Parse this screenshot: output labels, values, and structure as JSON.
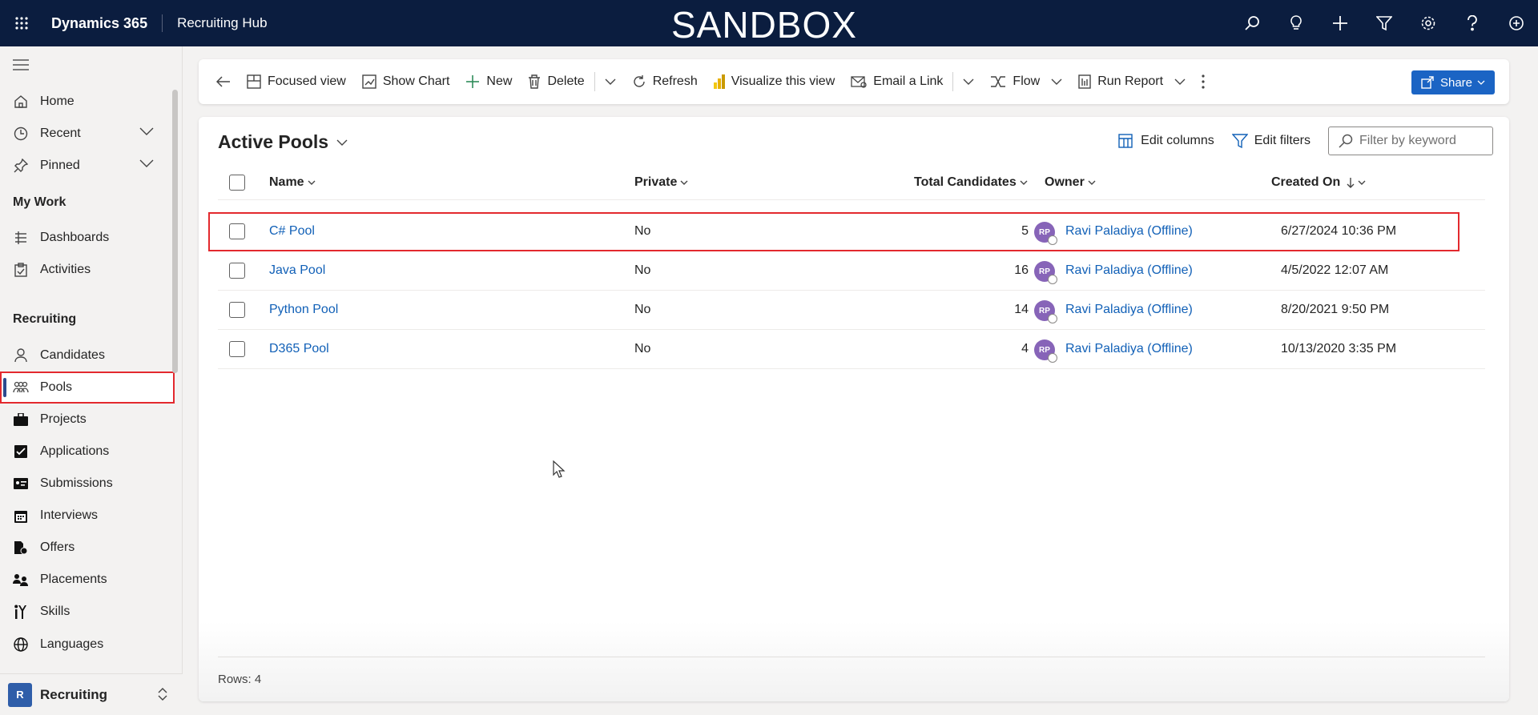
{
  "topbar": {
    "brand": "Dynamics 365",
    "app_name": "Recruiting Hub",
    "environment": "SANDBOX",
    "icons": [
      "search-icon",
      "lightbulb-icon",
      "plus-icon",
      "filter-icon",
      "gear-icon",
      "help-icon",
      "copilot-icon"
    ]
  },
  "sidebar": {
    "home": "Home",
    "recent": "Recent",
    "pinned": "Pinned",
    "my_work_title": "My Work",
    "dashboards": "Dashboards",
    "activities": "Activities",
    "recruiting_title": "Recruiting",
    "candidates": "Candidates",
    "pools": "Pools",
    "projects": "Projects",
    "applications": "Applications",
    "submissions": "Submissions",
    "interviews": "Interviews",
    "offers": "Offers",
    "placements": "Placements",
    "skills": "Skills",
    "languages": "Languages",
    "area_badge": "R",
    "area_label": "Recruiting"
  },
  "commandbar": {
    "focused_view": "Focused view",
    "show_chart": "Show Chart",
    "new": "New",
    "delete": "Delete",
    "refresh": "Refresh",
    "visualize": "Visualize this view",
    "email_link": "Email a Link",
    "flow": "Flow",
    "run_report": "Run Report",
    "share": "Share"
  },
  "view": {
    "title": "Active Pools",
    "edit_columns": "Edit columns",
    "edit_filters": "Edit filters",
    "filter_placeholder": "Filter by keyword",
    "columns": {
      "name": "Name",
      "private": "Private",
      "total": "Total Candidates",
      "owner": "Owner",
      "created": "Created On"
    },
    "rows": [
      {
        "name": "C# Pool",
        "private": "No",
        "total": "5",
        "owner_initials": "RP",
        "owner": "Ravi Paladiya (Offline)",
        "created": "6/27/2024 10:36 PM"
      },
      {
        "name": "Java Pool",
        "private": "No",
        "total": "16",
        "owner_initials": "RP",
        "owner": "Ravi Paladiya (Offline)",
        "created": "4/5/2022 12:07 AM"
      },
      {
        "name": "Python Pool",
        "private": "No",
        "total": "14",
        "owner_initials": "RP",
        "owner": "Ravi Paladiya (Offline)",
        "created": "8/20/2021 9:50 PM"
      },
      {
        "name": "D365 Pool",
        "private": "No",
        "total": "4",
        "owner_initials": "RP",
        "owner": "Ravi Paladiya (Offline)",
        "created": "10/13/2020 3:35 PM"
      }
    ],
    "footer": "Rows: 4"
  },
  "colors": {
    "topbar_bg": "#0b1d3f",
    "link": "#1160b7",
    "highlight": "#e3292e",
    "share_bg": "#1b64c4",
    "avatar_bg": "#8764b8"
  }
}
